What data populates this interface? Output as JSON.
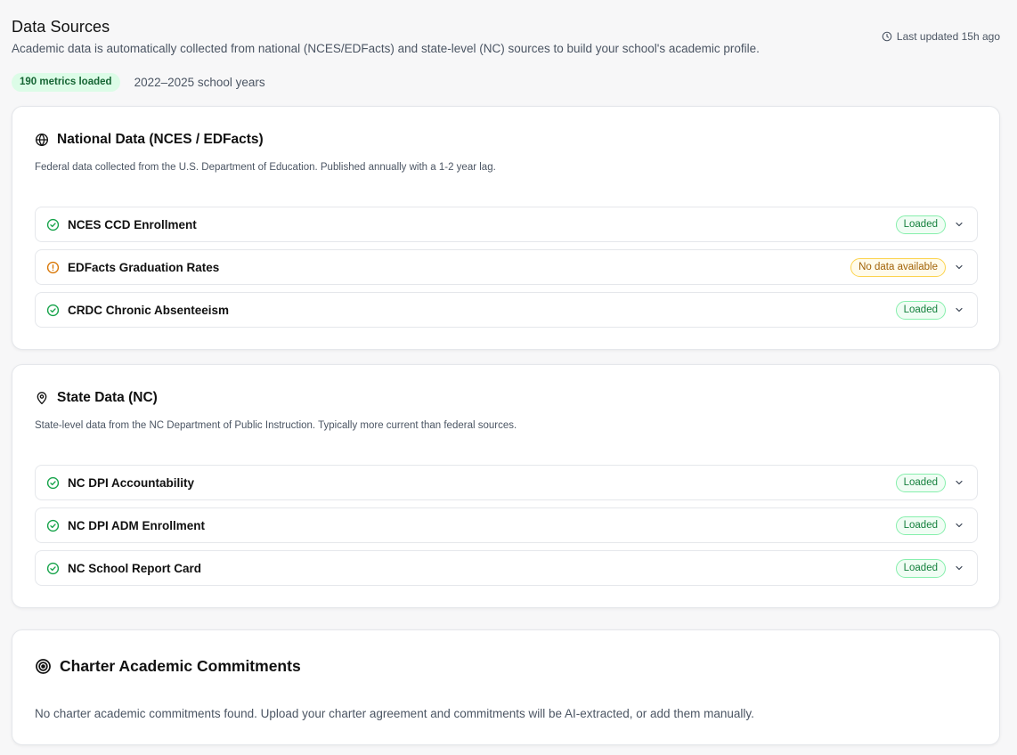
{
  "header": {
    "title": "Data Sources",
    "subtitle": "Academic data is automatically collected from national (NCES/EDFacts) and state-level (NC) sources to build your school's academic profile.",
    "last_updated": "Last updated 15h ago",
    "metrics_badge": "190 metrics loaded",
    "school_years": "2022–2025 school years"
  },
  "national": {
    "title": "National Data (NCES / EDFacts)",
    "description": "Federal data collected from the U.S. Department of Education. Published annually with a 1-2 year lag.",
    "sources": [
      {
        "name": "NCES CCD Enrollment",
        "status": "Loaded"
      },
      {
        "name": "EDFacts Graduation Rates",
        "status": "No data available"
      },
      {
        "name": "CRDC Chronic Absenteeism",
        "status": "Loaded"
      }
    ]
  },
  "state": {
    "title": "State Data (NC)",
    "description": "State-level data from the NC Department of Public Instruction. Typically more current than federal sources.",
    "sources": [
      {
        "name": "NC DPI Accountability",
        "status": "Loaded"
      },
      {
        "name": "NC DPI ADM Enrollment",
        "status": "Loaded"
      },
      {
        "name": "NC School Report Card",
        "status": "Loaded"
      }
    ]
  },
  "commitments": {
    "title": "Charter Academic Commitments",
    "empty_text": "No charter academic commitments found. Upload your charter agreement and commitments will be AI-extracted, or add them manually."
  },
  "colors": {
    "success": "#16a34a",
    "warning": "#d97706",
    "badge_bg": "#dcfce7"
  },
  "icons": {
    "last_updated": "clock-icon",
    "national": "globe-icon",
    "state": "map-pin-icon",
    "commitments": "target-icon",
    "loaded": "check-circle-icon",
    "no_data": "alert-circle-icon",
    "expand": "chevron-down-icon"
  }
}
